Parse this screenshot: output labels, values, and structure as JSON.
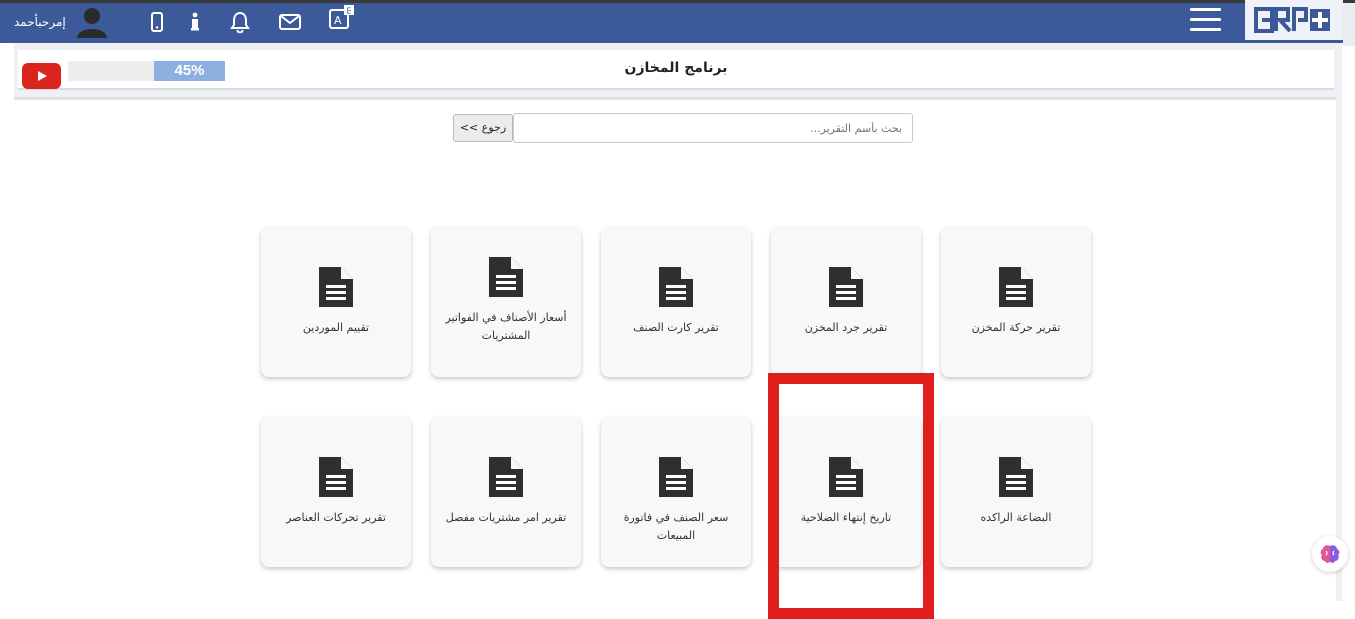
{
  "header": {
    "user_name": "إمرحبأحمد",
    "icons": [
      "user-avatar",
      "mobile-icon",
      "info-icon",
      "bell-icon",
      "mail-icon",
      "translate-icon"
    ],
    "logo_text": "ERP"
  },
  "titlebar": {
    "title": "برنامج المخازن",
    "progress_percent": 45,
    "progress_label": "45%"
  },
  "search": {
    "placeholder": "بحث بأسم التقرير...",
    "back_label": "<< رجوع"
  },
  "reports": {
    "row1": [
      {
        "label": "تقرير حركة المخزن"
      },
      {
        "label": "تقرير جرد المخزن"
      },
      {
        "label": "تقرير كارت الصنف"
      },
      {
        "label": "أسعار الأصناف في الفواتير المشتريات"
      },
      {
        "label": "تقييم الموردين"
      }
    ],
    "row2": [
      {
        "label": "البضاعة الراكده"
      },
      {
        "label": "تاريخ إنتهاء الصلاحية"
      },
      {
        "label": "سعر الصنف في فاتورة المبيعات"
      },
      {
        "label": "تقرير امر مشتريات مفصل"
      },
      {
        "label": "تقرير تحركات العناصر"
      }
    ]
  },
  "colors": {
    "topbar": "#3c5a99",
    "highlight": "#e01e1e",
    "progress": "#8eb0e0"
  }
}
